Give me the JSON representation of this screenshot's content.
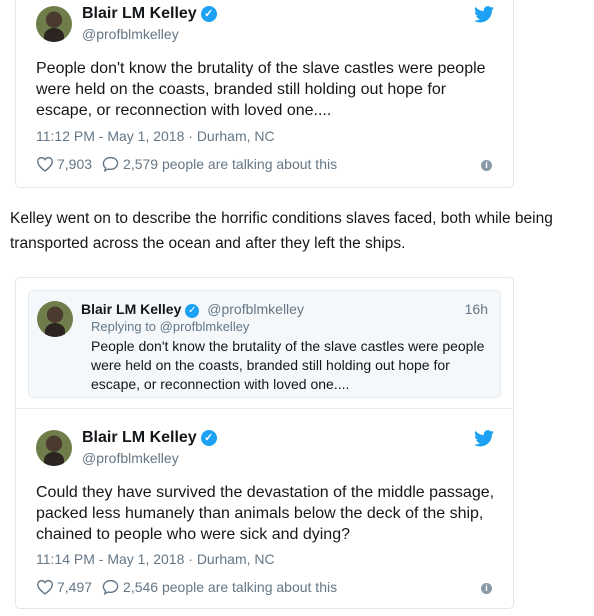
{
  "tweet1": {
    "name": "Blair LM Kelley",
    "handle": "@profblmkelley",
    "text": "People don't know the brutality of the slave castles were people were held on the coasts, branded still holding out hope for escape, or reconnection with loved one....",
    "timestamp": "11:12 PM - May 1, 2018 · Durham, NC",
    "likes": "7,903",
    "talking": "2,579 people are talking about this"
  },
  "paragraph": "Kelley went on to describe the horrific conditions slaves faced, both while being transported across the ocean and after they left the ships.",
  "tweet2": {
    "quoted": {
      "name": "Blair LM Kelley",
      "handle": "@profblmkelley",
      "time": "16h",
      "replying": "Replying to @profblmkelley",
      "text": "People don't know the brutality of the slave castles were people were held on the coasts, branded still holding out hope for escape, or reconnection with loved one...."
    },
    "name": "Blair LM Kelley",
    "handle": "@profblmkelley",
    "text": "Could they have survived the devastation of the middle passage, packed less humanely than animals below the deck of the ship, chained to people who were sick and dying?",
    "timestamp": "11:14 PM - May 1, 2018 · Durham, NC",
    "likes": "7,497",
    "talking": "2,546 people are talking about this"
  },
  "colors": {
    "twitter_blue": "#1da1f2",
    "muted": "#657786"
  }
}
